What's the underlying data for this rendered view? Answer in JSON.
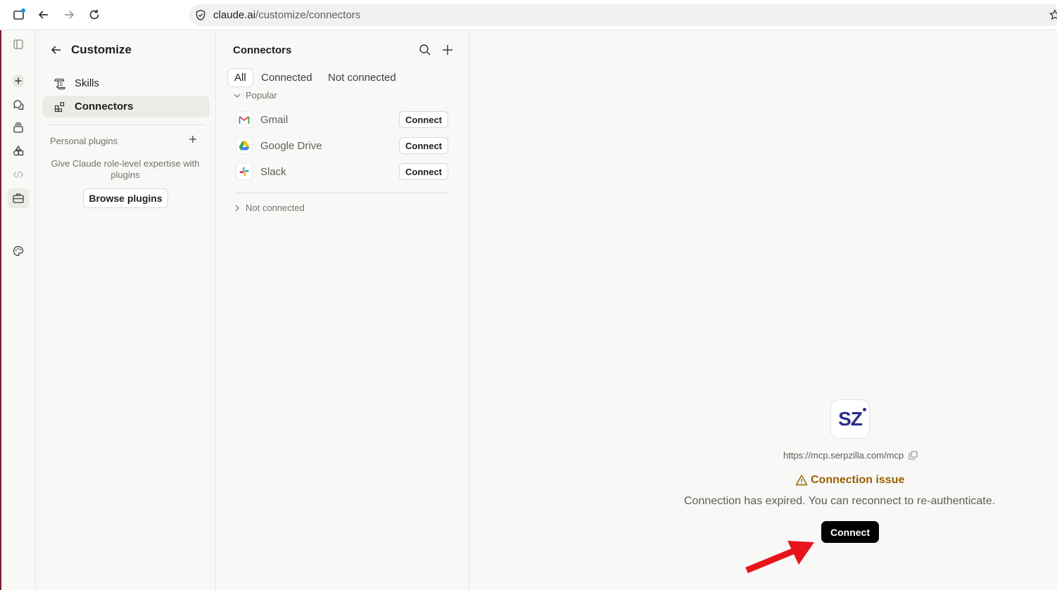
{
  "browser": {
    "url_host": "claude.ai",
    "url_path": "/customize/connectors"
  },
  "rail": {
    "icons": [
      "sidebar-toggle-icon",
      "new-chat-icon",
      "chats-icon",
      "projects-icon",
      "artifacts-icon",
      "code-icon",
      "customize-icon",
      "palette-icon"
    ]
  },
  "customize": {
    "title": "Customize",
    "nav": [
      {
        "label": "Skills",
        "icon": "skills-icon"
      },
      {
        "label": "Connectors",
        "icon": "connectors-icon",
        "active": true
      }
    ],
    "personal_plugins_label": "Personal plugins",
    "personal_plugins_desc": "Give Claude role-level expertise with plugins",
    "browse_plugins_label": "Browse plugins"
  },
  "connectors": {
    "title": "Connectors",
    "tabs": [
      {
        "label": "All",
        "active": true
      },
      {
        "label": "Connected"
      },
      {
        "label": "Not connected"
      }
    ],
    "popular_label": "Popular",
    "items": [
      {
        "name": "Gmail",
        "icon": "gmail-icon",
        "action": "Connect"
      },
      {
        "name": "Google Drive",
        "icon": "google-drive-icon",
        "action": "Connect"
      },
      {
        "name": "Slack",
        "icon": "slack-icon",
        "action": "Connect"
      }
    ],
    "not_connected_label": "Not connected"
  },
  "detail": {
    "logo_text": "SZ",
    "url": "https://mcp.serpzilla.com/mcp",
    "issue_title": "Connection issue",
    "issue_desc": "Connection has expired. You can reconnect to re-authenticate.",
    "connect_label": "Connect",
    "colors": {
      "warning": "#9a6100",
      "logo": "#2a2f8f",
      "annotation_arrow": "#e8141b"
    }
  }
}
